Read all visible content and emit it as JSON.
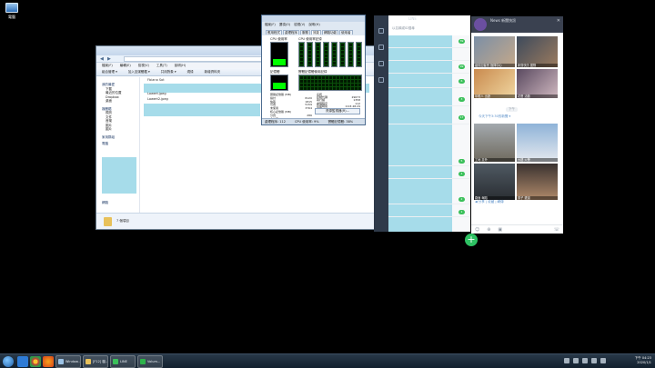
{
  "desktop": {
    "icon_label": "電腦"
  },
  "explorer": {
    "menu": [
      "檔案(F)",
      "編輯(E)",
      "檢視(V)",
      "工具(T)",
      "說明(H)"
    ],
    "toolbar": [
      "組合管理 ▾",
      "加入至媒體櫃 ▾",
      "共用對象 ▾",
      "燒錄",
      "新增資料夾"
    ],
    "nav": {
      "favorites_label": "我的最愛",
      "favorites": [
        "下載",
        "最近的位置",
        "Dropbox",
        "桌面"
      ],
      "libraries_label": "媒體櫃",
      "libraries": [
        "視訊",
        "文件",
        "音樂",
        "圖片",
        "圖片"
      ],
      "homegroup_label": "家用群組",
      "computer_label": "電腦",
      "network_label": "網路"
    },
    "files": [
      "Fbiana Sot",
      "",
      "Lowert.jpeg",
      "Lowert2.jpeg"
    ],
    "status_text": "7 個項目"
  },
  "taskmgr": {
    "menu": [
      "檔案(F)",
      "選項(O)",
      "檢視(V)",
      "說明(H)"
    ],
    "tabs": [
      "應用程式",
      "處理程序",
      "服務",
      "效能",
      "網路功能",
      "使用者"
    ],
    "cpu_label": "CPU 使用率",
    "cpu_history_label": "CPU 使用率記錄",
    "mem_label": "記憶體",
    "mem_history_label": "實體記憶體使用記錄",
    "phys_mem_label": "實體記憶體 (MB)",
    "phys_mem_rows": [
      "總計",
      "快取",
      "可用",
      "未使用"
    ],
    "phys_mem_vals": [
      "8120",
      "1815",
      "5159",
      "3764"
    ],
    "kernel_mem_label": "核心記憶體 (MB)",
    "kernel_rows": [
      "分頁",
      "非分頁"
    ],
    "kernel_vals": [
      "286",
      "170"
    ],
    "system_label": "系統",
    "system_rows": [
      "控制代碼",
      "執行緒",
      "處理程序",
      "存留時間",
      "認可 (MB)"
    ],
    "system_vals": [
      "29673",
      "1358",
      "112",
      "0:03:48:29",
      "3521 / 17"
    ],
    "resource_button": "資源監視器(R)...",
    "status": [
      "處理程序: 112",
      "CPU 使用率: 9%",
      "實體記憶體: 38%"
    ]
  },
  "line": {
    "header_title": "LINE",
    "search_placeholder": "以名稱或ID搜尋",
    "badges": [
      "39",
      "99",
      "6",
      "3",
      "17",
      "5",
      "4",
      "2",
      "1"
    ],
    "fab": "+"
  },
  "news": {
    "header_name": "News 新聞快訊",
    "card1_captions": [
      "疫情記者會 指揮中心",
      "新聞快訊 國際",
      "年輕人 出遊",
      "花燈 活動"
    ],
    "card1_time": "下午",
    "card1_meta": "今天下午3:30的新聞 ▾",
    "card2_captions": [
      "工地 意外",
      "大樓 火警",
      "路面 塌陷",
      "男子 遭逮"
    ],
    "card2_meta": "◀ 分享 | 收藏 | 轉傳"
  },
  "taskbar": {
    "tasks": [
      "Window...",
      "[F12] 檔...",
      "LINE",
      "Volum..."
    ],
    "time": "下午 04:23",
    "date": "2020/1/1"
  }
}
